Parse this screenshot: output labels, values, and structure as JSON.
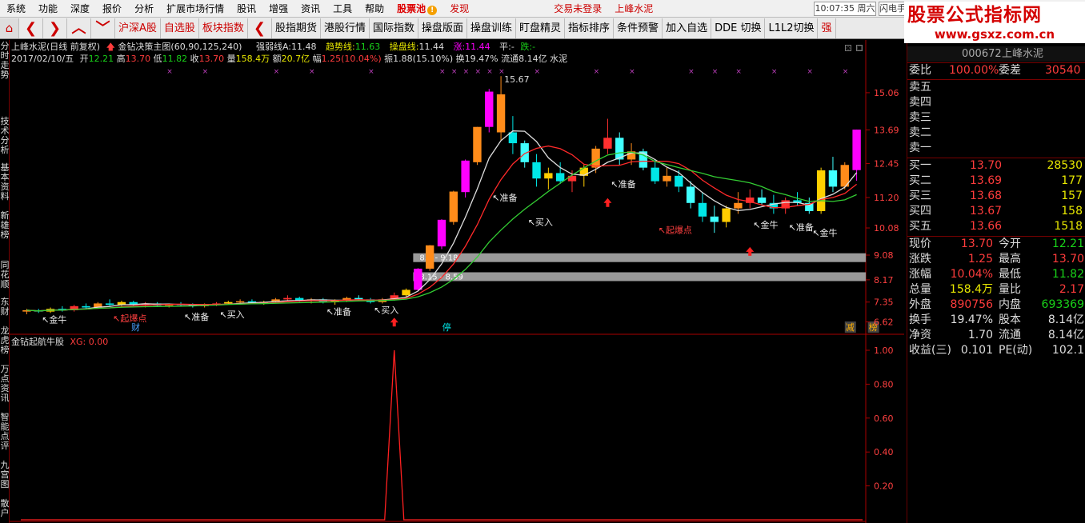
{
  "menu": {
    "items": [
      "系统",
      "功能",
      "深度",
      "报价",
      "分析",
      "扩展市场行情",
      "股讯",
      "增强",
      "资讯",
      "工具",
      "帮助"
    ],
    "stock_pool": "股票池",
    "discover": "发现",
    "trade_status": "交易未登录",
    "stock_name": "上峰水泥",
    "clock": "10:07:35 周六",
    "flash": "闪电手"
  },
  "logo": {
    "title": "股票公式指标网",
    "url": "www.gsxz.com.cn"
  },
  "toolbar": {
    "home": "⌂",
    "items": [
      "沪深A股",
      "自选股",
      "板块指数",
      "股指期货",
      "港股行情",
      "国际指数",
      "操盘版面",
      "操盘训练",
      "盯盘精灵",
      "指标排序",
      "条件预警",
      "加入自选",
      "DDE 切换",
      "L1L2切换",
      "强"
    ]
  },
  "side_tabs": [
    "分时走势",
    "技术分析",
    "基本资料",
    "新雄榜",
    "同花顺",
    "东财",
    "龙虎榜",
    "万点资讯",
    "智能点评",
    "九宫图",
    "散户"
  ],
  "chart_header": {
    "stock": "上峰水泥(日线 前复权)",
    "indicator": "金钻决策主图(60,90,125,240)",
    "strong_label": "强弱线A:",
    "strong_value": "11.48",
    "trend_label": "趋势线:",
    "trend_value": "11.63",
    "operate_label": "操盘线:",
    "operate_value": "11.44",
    "rise_label": "涨:",
    "rise_value": "11.44",
    "flat_label": "平:",
    "flat_value": "-",
    "fall_label": "跌:",
    "fall_value": "-",
    "date": "2017/02/10/五",
    "open_label": "开",
    "open": "12.21",
    "high_label": "高",
    "high": "13.70",
    "low_label": "低",
    "low": "11.82",
    "close_label": "收",
    "close": "13.70",
    "vol_label": "量",
    "vol": "158.4万",
    "amt_label": "额",
    "amt": "20.7亿",
    "chg_label": "幅",
    "chg": "1.25(10.04%)",
    "amp_label": "振",
    "amp": "1.88(15.10%)",
    "turn_label": "换",
    "turn": "19.47%",
    "float_label": "流通",
    "float": "8.14亿",
    "sector": "水泥"
  },
  "sub_header": {
    "name": "金钻起航牛股",
    "xg": "XG: 0.00"
  },
  "chart_data": [
    {
      "type": "candlestick",
      "price_axis": [
        "15.06",
        "13.69",
        "12.45",
        "11.20",
        "10.08",
        "9.08",
        "8.17",
        "7.35",
        "6.62"
      ],
      "price_range": [
        6.4,
        16.0
      ],
      "high_label": "15.67",
      "bands": [
        {
          "label": "8.9 - 9.18",
          "value": 9.0
        },
        {
          "label": "8.15 - 8.59",
          "value": 8.3
        }
      ],
      "signals": [
        "金牛",
        "起爆点",
        "准备",
        "买入",
        "准备",
        "买入",
        "准备",
        "买入",
        "准备",
        "起爆点",
        "金牛",
        "准备",
        "金牛"
      ],
      "bottom_marks": [
        "财",
        "停",
        "减",
        "榜"
      ],
      "candles": [
        [
          7.0,
          7.1,
          6.9,
          7.05
        ],
        [
          7.05,
          7.1,
          6.95,
          7.0
        ],
        [
          7.0,
          7.15,
          6.95,
          7.1
        ],
        [
          7.1,
          7.2,
          7.0,
          7.05
        ],
        [
          7.05,
          7.25,
          7.0,
          7.2
        ],
        [
          7.2,
          7.3,
          7.1,
          7.15
        ],
        [
          7.15,
          7.35,
          7.1,
          7.3
        ],
        [
          7.3,
          7.45,
          7.2,
          7.25
        ],
        [
          7.25,
          7.4,
          7.2,
          7.35
        ],
        [
          7.35,
          7.4,
          7.2,
          7.25
        ],
        [
          7.25,
          7.35,
          7.15,
          7.3
        ],
        [
          7.3,
          7.35,
          7.2,
          7.22
        ],
        [
          7.22,
          7.3,
          7.15,
          7.28
        ],
        [
          7.28,
          7.35,
          7.2,
          7.25
        ],
        [
          7.25,
          7.3,
          7.15,
          7.2
        ],
        [
          7.2,
          7.3,
          7.15,
          7.27
        ],
        [
          7.27,
          7.35,
          7.2,
          7.3
        ],
        [
          7.3,
          7.4,
          7.25,
          7.35
        ],
        [
          7.35,
          7.45,
          7.3,
          7.38
        ],
        [
          7.38,
          7.45,
          7.3,
          7.32
        ],
        [
          7.32,
          7.4,
          7.25,
          7.36
        ],
        [
          7.36,
          7.5,
          7.3,
          7.45
        ],
        [
          7.45,
          7.6,
          7.4,
          7.5
        ],
        [
          7.5,
          7.55,
          7.35,
          7.4
        ],
        [
          7.4,
          7.5,
          7.3,
          7.45
        ],
        [
          7.45,
          7.5,
          7.3,
          7.35
        ],
        [
          7.35,
          7.45,
          7.25,
          7.4
        ],
        [
          7.4,
          7.55,
          7.35,
          7.5
        ],
        [
          7.5,
          7.6,
          7.4,
          7.45
        ],
        [
          7.45,
          7.5,
          7.3,
          7.35
        ],
        [
          7.35,
          7.5,
          7.3,
          7.45
        ],
        [
          7.45,
          7.7,
          7.4,
          7.6
        ],
        [
          7.6,
          7.85,
          7.55,
          7.8
        ],
        [
          7.8,
          8.6,
          7.75,
          8.58
        ],
        [
          8.58,
          9.45,
          8.5,
          9.44
        ],
        [
          9.4,
          10.4,
          9.3,
          10.38
        ],
        [
          10.3,
          11.45,
          10.2,
          11.42
        ],
        [
          11.4,
          12.6,
          11.2,
          12.56
        ],
        [
          12.5,
          13.8,
          12.4,
          13.8
        ],
        [
          13.8,
          15.2,
          13.6,
          15.1
        ],
        [
          15.0,
          15.67,
          13.3,
          13.6
        ],
        [
          13.6,
          14.2,
          12.8,
          13.2
        ],
        [
          13.2,
          13.3,
          12.3,
          12.5
        ],
        [
          12.5,
          12.8,
          11.6,
          11.9
        ],
        [
          11.9,
          12.3,
          11.5,
          12.1
        ],
        [
          12.1,
          12.5,
          11.7,
          11.8
        ],
        [
          11.8,
          12.2,
          11.4,
          12.0
        ],
        [
          12.0,
          12.4,
          11.6,
          12.3
        ],
        [
          12.3,
          13.1,
          12.1,
          13.0
        ],
        [
          13.0,
          14.1,
          12.8,
          13.4
        ],
        [
          13.4,
          13.6,
          12.4,
          12.6
        ],
        [
          12.6,
          13.2,
          12.4,
          12.9
        ],
        [
          12.9,
          13.0,
          12.2,
          12.3
        ],
        [
          12.3,
          12.6,
          11.7,
          11.8
        ],
        [
          11.8,
          12.3,
          11.6,
          12.0
        ],
        [
          12.0,
          12.2,
          11.4,
          11.6
        ],
        [
          11.6,
          11.8,
          10.8,
          11.0
        ],
        [
          11.0,
          11.4,
          10.3,
          10.5
        ],
        [
          10.5,
          10.9,
          9.9,
          10.3
        ],
        [
          10.3,
          10.9,
          10.1,
          10.8
        ],
        [
          10.8,
          11.4,
          10.6,
          11.0
        ],
        [
          11.0,
          11.5,
          10.8,
          11.2
        ],
        [
          11.2,
          11.5,
          10.9,
          11.0
        ],
        [
          11.0,
          11.3,
          10.6,
          10.8
        ],
        [
          10.8,
          11.2,
          10.6,
          11.1
        ],
        [
          11.1,
          11.4,
          10.9,
          11.0
        ],
        [
          11.0,
          11.2,
          10.6,
          10.7
        ],
        [
          10.7,
          12.3,
          10.6,
          12.2
        ],
        [
          12.2,
          12.7,
          11.4,
          11.6
        ],
        [
          11.6,
          12.5,
          11.5,
          12.4
        ],
        [
          12.21,
          13.7,
          11.82,
          13.7
        ]
      ],
      "ma_lines": [
        {
          "name": "white",
          "color": "#dddddd"
        },
        {
          "name": "red",
          "color": "#ff2a2a"
        },
        {
          "name": "green",
          "color": "#33cc33"
        }
      ]
    },
    {
      "type": "line",
      "name": "金钻起航牛股",
      "y_axis": [
        "1.00",
        "0.80",
        "0.60",
        "0.40",
        "0.20"
      ],
      "ylim": [
        0,
        1
      ],
      "spike_index": 31
    }
  ],
  "quote": {
    "code": "000672",
    "name": "上峰水泥",
    "weibi_label": "委比",
    "weibi": "100.00%",
    "weicha_label": "委差",
    "weicha": "30540",
    "sell": [
      "卖五",
      "卖四",
      "卖三",
      "卖二",
      "卖一"
    ],
    "buy": [
      {
        "label": "买一",
        "price": "13.70",
        "vol": "28530"
      },
      {
        "label": "买二",
        "price": "13.69",
        "vol": "177"
      },
      {
        "label": "买三",
        "price": "13.68",
        "vol": "157"
      },
      {
        "label": "买四",
        "price": "13.67",
        "vol": "158"
      },
      {
        "label": "买五",
        "price": "13.66",
        "vol": "1518"
      }
    ],
    "stats": [
      {
        "l1": "现价",
        "v1": "13.70",
        "c1": "r",
        "l2": "今开",
        "v2": "12.21",
        "c2": "g"
      },
      {
        "l1": "涨跌",
        "v1": "1.25",
        "c1": "r",
        "l2": "最高",
        "v2": "13.70",
        "c2": "r"
      },
      {
        "l1": "涨幅",
        "v1": "10.04%",
        "c1": "r",
        "l2": "最低",
        "v2": "11.82",
        "c2": "g"
      },
      {
        "l1": "总量",
        "v1": "158.4万",
        "c1": "y",
        "l2": "量比",
        "v2": "2.17",
        "c2": "r"
      },
      {
        "l1": "外盘",
        "v1": "890756",
        "c1": "r",
        "l2": "内盘",
        "v2": "693369",
        "c2": "g"
      },
      {
        "l1": "换手",
        "v1": "19.47%",
        "c1": "w",
        "l2": "股本",
        "v2": "8.14亿",
        "c2": "w"
      },
      {
        "l1": "净资",
        "v1": "1.70",
        "c1": "w",
        "l2": "流通",
        "v2": "8.14亿",
        "c2": "w"
      },
      {
        "l1": "收益(三)",
        "v1": "0.101",
        "c1": "w",
        "l2": "PE(动)",
        "v2": "102.1",
        "c2": "w"
      }
    ]
  }
}
